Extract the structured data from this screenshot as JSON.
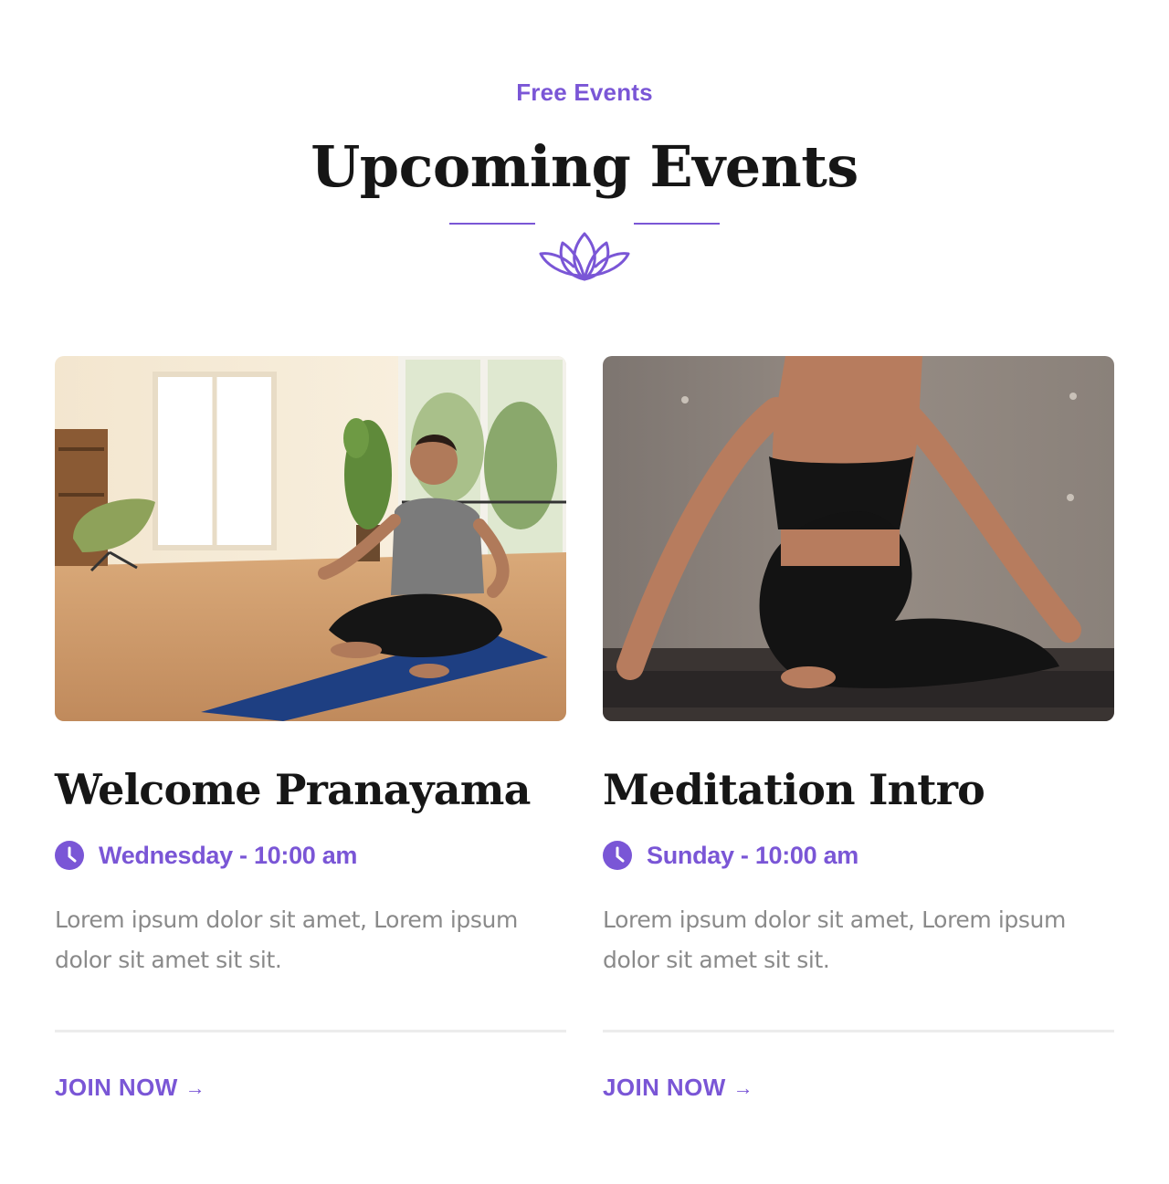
{
  "header": {
    "eyebrow": "Free Events",
    "title": "Upcoming Events"
  },
  "colors": {
    "accent": "#7a56d6",
    "heading": "#161616",
    "body_text": "#8a8a8a",
    "rule": "#ececec"
  },
  "events": [
    {
      "title": "Welcome Pranayama",
      "schedule": "Wednesday - 10:00 am",
      "description": "Lorem ipsum dolor sit amet, Lorem ipsum dolor sit amet sit sit.",
      "cta": "JOIN NOW",
      "cta_icon": "→",
      "image_icon": "meditation-photo"
    },
    {
      "title": "Meditation Intro",
      "schedule": "Sunday - 10:00 am",
      "description": "Lorem ipsum dolor sit amet, Lorem ipsum dolor sit amet sit sit.",
      "cta": "JOIN NOW",
      "cta_icon": "→",
      "image_icon": "yoga-twist-photo"
    }
  ],
  "icons": {
    "divider": "lotus-icon",
    "schedule": "clock-icon",
    "cta": "arrow-right-icon"
  }
}
